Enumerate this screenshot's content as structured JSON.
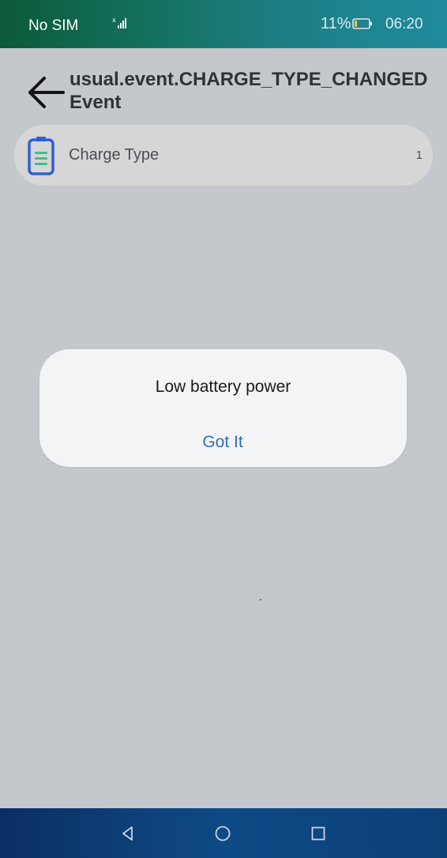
{
  "status_bar": {
    "carrier": "No SIM",
    "signal_icon": "signal-bars-icon",
    "battery_percent": "11%",
    "battery_icon": "battery-icon",
    "time": "06:20"
  },
  "header": {
    "back_icon": "arrow-left-icon",
    "title": "usual.event.CHARGE_TYPE_CHANGED Event"
  },
  "list": {
    "items": [
      {
        "icon": "battery-clipboard-icon",
        "label": "Charge Type",
        "value": "1"
      }
    ]
  },
  "dialog": {
    "message": "Low battery power",
    "button_label": "Got It",
    "button_color": "#2f6fb0"
  },
  "nav_bar": {
    "back_icon": "triangle-back-icon",
    "home_icon": "circle-home-icon",
    "recents_icon": "square-recents-icon"
  },
  "colors": {
    "background": "#c4c7cc",
    "dialog_bg": "#f3f4f6",
    "list_item_bg": "#d6d6d6"
  }
}
